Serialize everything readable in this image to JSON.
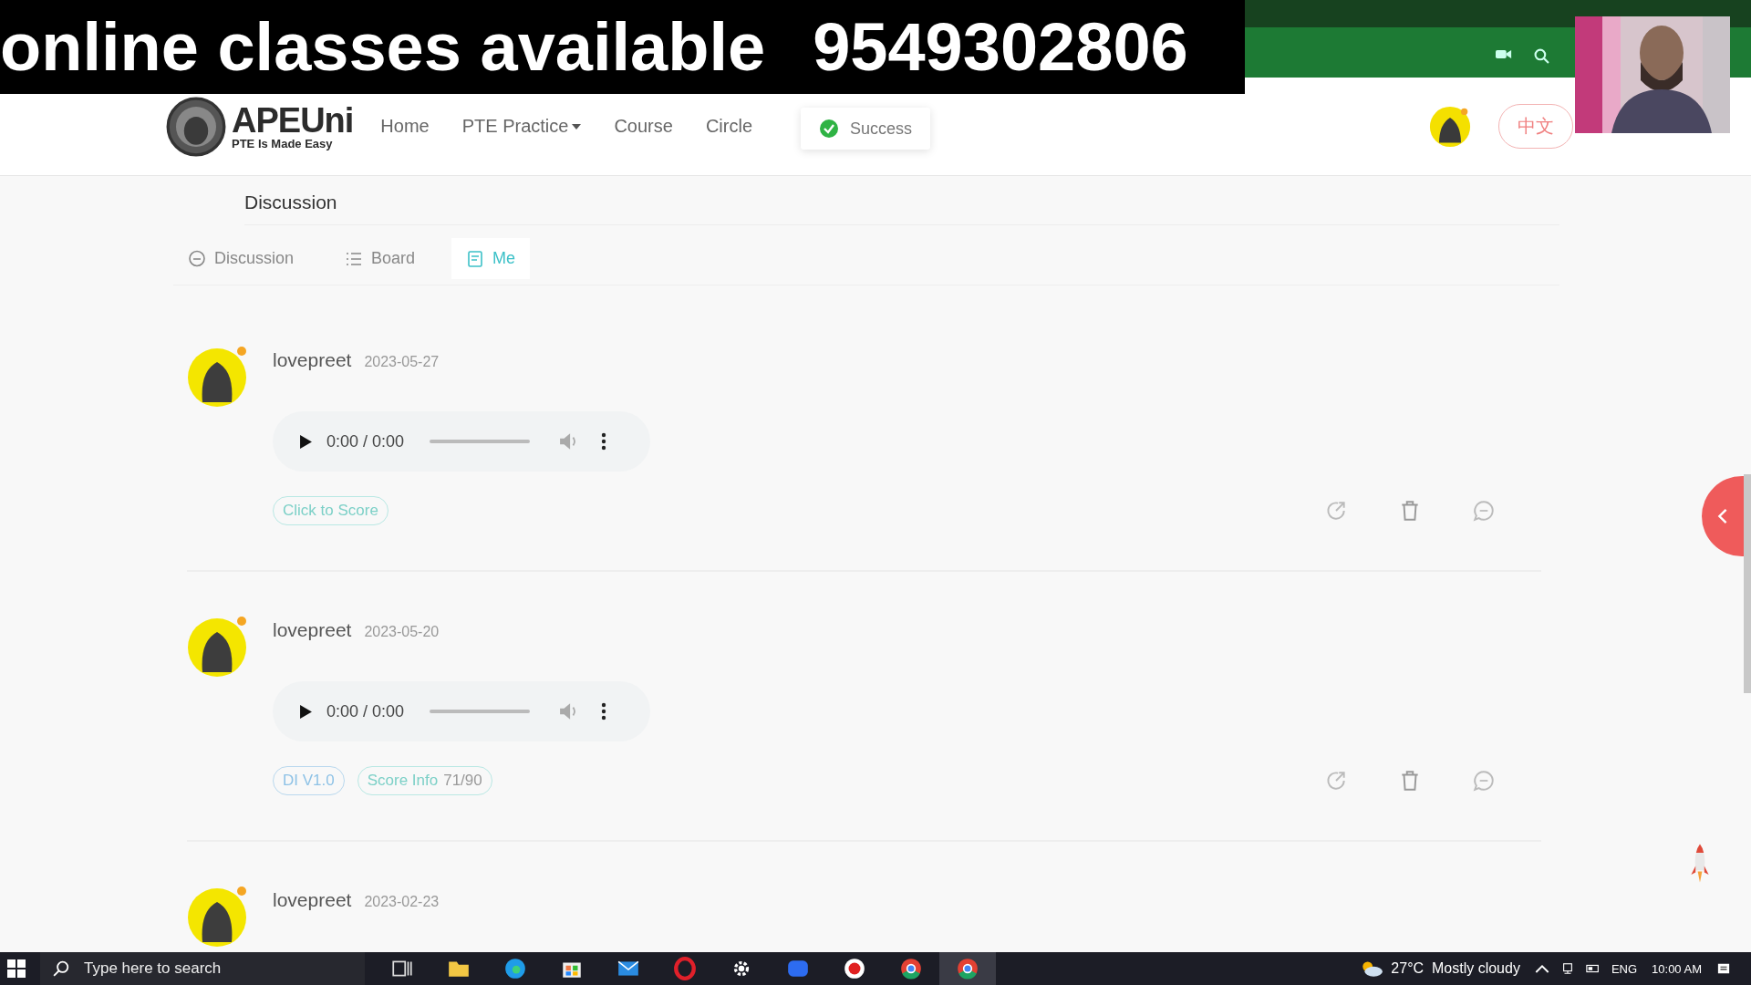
{
  "overlay_banner": {
    "text": "online classes available",
    "phone": "9549302806"
  },
  "navbar": {
    "logo": {
      "name": "APEUni",
      "tagline": "PTE Is Made Easy"
    },
    "links": [
      {
        "label": "Home",
        "dropdown": false
      },
      {
        "label": "PTE Practice",
        "dropdown": true
      },
      {
        "label": "Course",
        "dropdown": false
      },
      {
        "label": "Circle",
        "dropdown": false
      }
    ],
    "toast": {
      "kind": "success",
      "text": "Success"
    },
    "language_button": "中文"
  },
  "page_title": "Discussion",
  "tabs": [
    {
      "kind": "discussion",
      "label": "Discussion",
      "selected": false
    },
    {
      "kind": "board",
      "label": "Board",
      "selected": false
    },
    {
      "kind": "me",
      "label": "Me",
      "selected": true
    }
  ],
  "posts": [
    {
      "user": "lovepreet",
      "date": "2023-05-27",
      "audio": {
        "time": "0:00 / 0:00"
      },
      "tags": [
        {
          "kind": "action",
          "label": "Click to Score"
        }
      ]
    },
    {
      "user": "lovepreet",
      "date": "2023-05-20",
      "audio": {
        "time": "0:00 / 0:00"
      },
      "tags": [
        {
          "kind": "version",
          "label": "DI V1.0"
        },
        {
          "kind": "score",
          "label": "Score Info",
          "value": "71/90"
        }
      ]
    },
    {
      "user": "lovepreet",
      "date": "2023-02-23"
    }
  ],
  "taskbar": {
    "search": {
      "placeholder": "Type here to search"
    },
    "weather": "27°C  Mostly cloudy",
    "language": "ENG",
    "time": "10:00 AM"
  }
}
